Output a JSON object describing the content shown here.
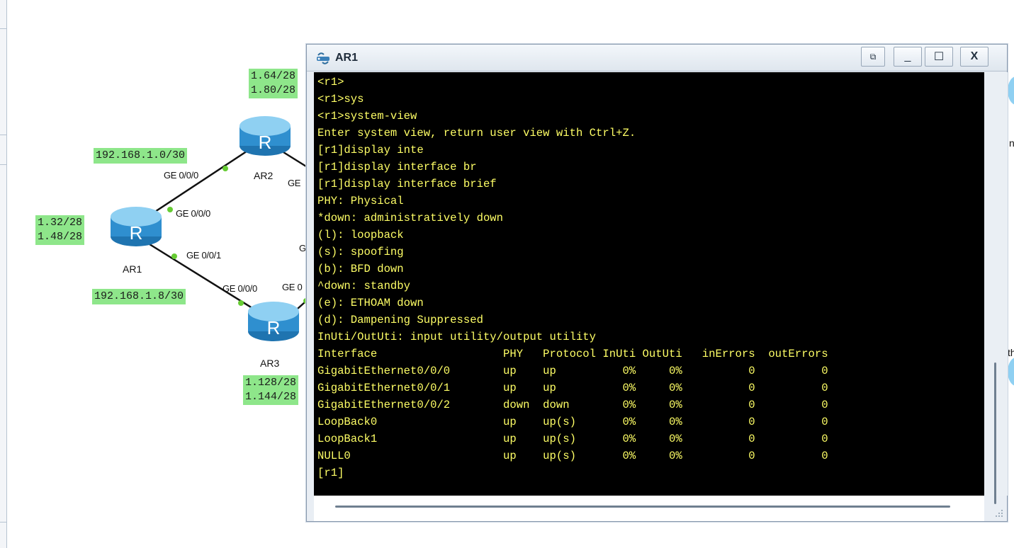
{
  "topology": {
    "routers": [
      {
        "id": "AR1",
        "label": "AR1"
      },
      {
        "id": "AR2",
        "label": "AR2"
      },
      {
        "id": "AR3",
        "label": "AR3"
      }
    ],
    "ip_labels": {
      "ar2_addr": "1.64/28\n1.80/28",
      "link_ar1_ar2": "192.168.1.0/30",
      "ar1_addr": "1.32/28\n1.48/28",
      "link_ar1_ar3": "192.168.1.8/30",
      "ar3_addr": "1.128/28\n1.144/28"
    },
    "port_labels": {
      "ar2_ge000": "GE 0/0/0",
      "ar2_ge_right": "GE",
      "ar1_ge000": "GE 0/0/0",
      "ar1_ge001": "GE 0/0/1",
      "mid_g": "G",
      "ar3_ge000": "GE 0/0/0",
      "ar3_ge_right": "GE 0"
    },
    "right_edge": {
      "top": "n",
      "bottom": "th"
    },
    "colors": {
      "ip_label_bg": "#8ee68a",
      "router_blue": "#3ea3dc",
      "link_dot": "#66cc33"
    }
  },
  "terminal": {
    "title": "AR1",
    "icon": "router-terminal-icon",
    "buttons": {
      "restore_glyph": "⧉",
      "minimize_glyph": "_",
      "maximize_glyph": "☐",
      "close_glyph": "X"
    },
    "text_color": "#ffff66",
    "lines": [
      "<r1>",
      "<r1>sys",
      "<r1>system-view",
      "Enter system view, return user view with Ctrl+Z.",
      "[r1]display inte",
      "[r1]display interface br",
      "[r1]display interface brief",
      "PHY: Physical",
      "*down: administratively down",
      "(l): loopback",
      "(s): spoofing",
      "(b): BFD down",
      "^down: standby",
      "(e): ETHOAM down",
      "(d): Dampening Suppressed",
      "InUti/OutUti: input utility/output utility",
      "Interface                   PHY   Protocol InUti OutUti   inErrors  outErrors",
      "GigabitEthernet0/0/0        up    up          0%     0%          0          0",
      "GigabitEthernet0/0/1        up    up          0%     0%          0          0",
      "GigabitEthernet0/0/2        down  down        0%     0%          0          0",
      "LoopBack0                   up    up(s)       0%     0%          0          0",
      "LoopBack1                   up    up(s)       0%     0%          0          0",
      "NULL0                       up    up(s)       0%     0%          0          0",
      "[r1]"
    ]
  }
}
